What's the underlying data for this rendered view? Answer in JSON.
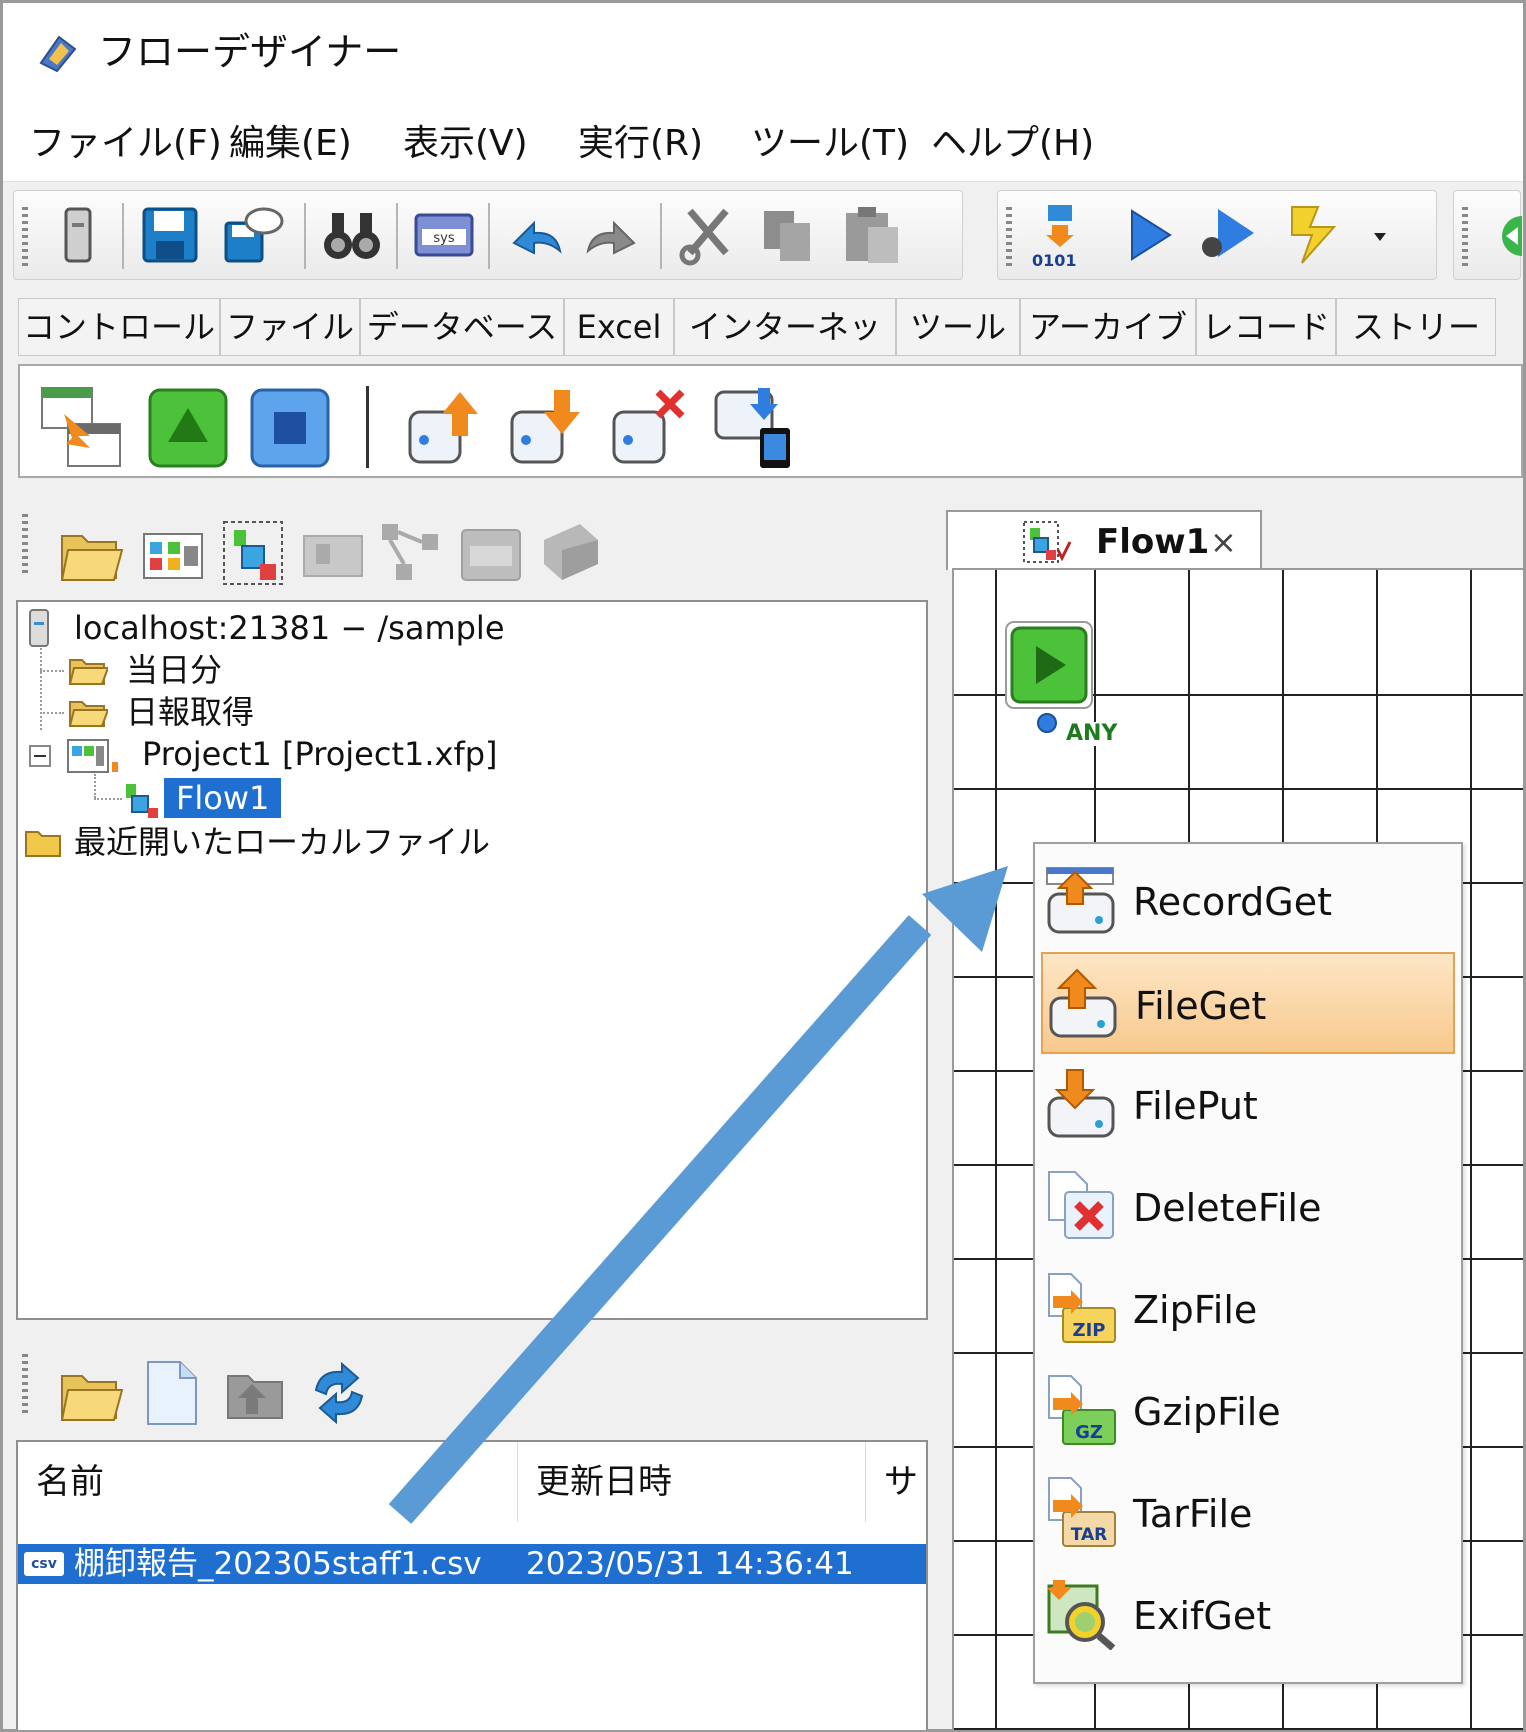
{
  "window": {
    "title": "フローデザイナー"
  },
  "menu": [
    "ファイル(F)",
    "編集(E)",
    "表示(V)",
    "実行(R)",
    "ツール(T)",
    "ヘルプ(H)"
  ],
  "toolbar": {
    "icons": [
      "server-icon",
      "save-icon",
      "save-as-icon",
      "binoculars-icon",
      "sys-icon",
      "undo-icon",
      "redo-icon",
      "cut-icon",
      "copy-icon",
      "paste-icon",
      "compile-icon",
      "run-icon",
      "debug-run-icon",
      "lightning-icon",
      "dropdown-icon"
    ],
    "compile_label": "0101"
  },
  "palette_tabs": [
    "コントロール",
    "ファイル",
    "データベース",
    "Excel",
    "インターネット",
    "ツール",
    "アーカイブ",
    "レコード",
    "ストリーム"
  ],
  "palette_icons": [
    "table-convert-icon",
    "start-icon",
    "stop-icon",
    "file-get-icon",
    "file-put-icon",
    "delete-file-icon",
    "mobile-sync-icon"
  ],
  "explorer": {
    "toolbar_icons": [
      "open-folder-icon",
      "project-icon",
      "flow-icon",
      "disabled-icon-1",
      "disabled-icon-2",
      "disabled-icon-3",
      "disabled-icon-4"
    ],
    "tree": {
      "root": "localhost:21381 − /sample",
      "folder1": "当日分",
      "folder2": "日報取得",
      "project": "Project1 [Project1.xfp]",
      "flow": "Flow1",
      "recent": "最近開いたローカルファイル"
    }
  },
  "file_list": {
    "toolbar_icons": [
      "open-folder-icon",
      "new-file-icon",
      "folder-up-icon",
      "refresh-icon"
    ],
    "columns": [
      "名前",
      "更新日時",
      "サ"
    ],
    "rows": [
      {
        "name": "棚卸報告_202305staff1.csv",
        "modified": "2023/05/31 14:36:41"
      }
    ],
    "csv_badge": "csv"
  },
  "editor": {
    "tab_label": "Flow1",
    "close_symbol": "×",
    "start_node_port": "ANY"
  },
  "popup_menu": {
    "items": [
      {
        "label": "RecordGet",
        "icon": "record-get-icon"
      },
      {
        "label": "FileGet",
        "icon": "file-get-icon",
        "highlighted": true
      },
      {
        "label": "FilePut",
        "icon": "file-put-icon"
      },
      {
        "label": "DeleteFile",
        "icon": "delete-file-icon"
      },
      {
        "label": "ZipFile",
        "icon": "zip-file-icon",
        "badge": "ZIP"
      },
      {
        "label": "GzipFile",
        "icon": "gzip-file-icon",
        "badge": "GZ"
      },
      {
        "label": "TarFile",
        "icon": "tar-file-icon",
        "badge": "TAR"
      },
      {
        "label": "ExifGet",
        "icon": "exif-get-icon"
      }
    ]
  },
  "colors": {
    "selection": "#1f6fd1",
    "arrow": "#5b9bd5",
    "highlight": "#f8c98d",
    "start_green": "#3fbf2f",
    "stop_blue": "#3b82d8"
  }
}
